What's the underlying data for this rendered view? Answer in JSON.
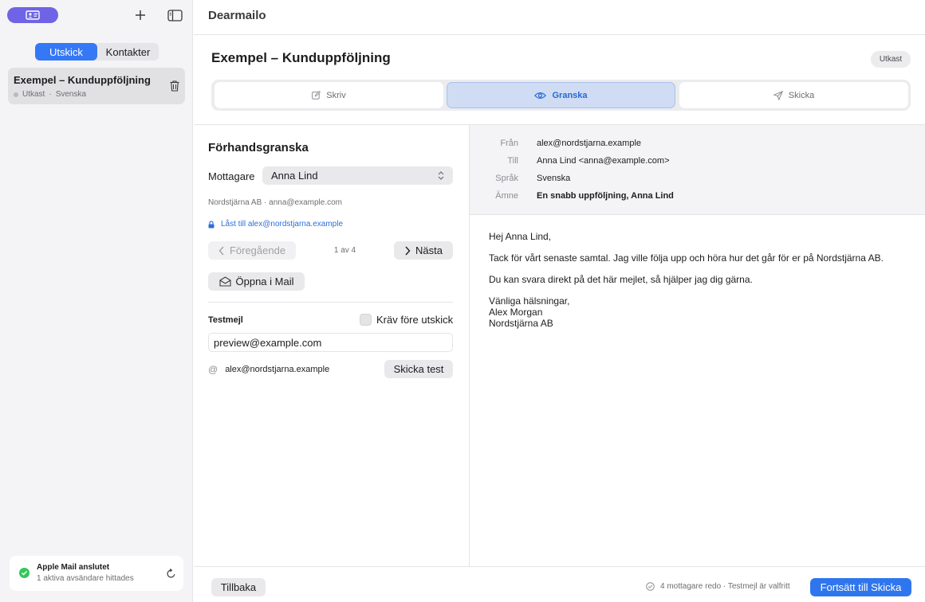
{
  "sidebar": {
    "segments": [
      {
        "label": "Utskick",
        "active": true
      },
      {
        "label": "Kontakter",
        "active": false
      }
    ],
    "campaigns": [
      {
        "title": "Exempel – Kunduppföljning",
        "status": "Utkast",
        "separator": "·",
        "language": "Svenska"
      }
    ],
    "status_card": {
      "title": "Apple Mail anslutet",
      "subtitle": "1 aktiva avsändare hittades"
    },
    "icons": {
      "app": "contact-card-icon",
      "add": "plus-icon",
      "toggle": "sidebar-toggle-icon",
      "delete": "trash-icon",
      "status": "checkmark-circle-icon",
      "refresh": "refresh-icon"
    }
  },
  "header": {
    "app_title": "Dearmailo",
    "doc_title": "Exempel – Kunduppföljning",
    "badge": "Utkast"
  },
  "steps": [
    {
      "label": "Skriv",
      "icon": "edit-icon",
      "active": false
    },
    {
      "label": "Granska",
      "icon": "eye-icon",
      "active": true
    },
    {
      "label": "Skicka",
      "icon": "send-icon",
      "active": false
    }
  ],
  "preview_panel": {
    "heading": "Förhandsgranska",
    "recipient_label": "Mottagare",
    "recipient_value": "Anna Lind",
    "recipient_meta": "Nordstjärna AB · anna@example.com",
    "locked_text": "Låst till alex@nordstjarna.example",
    "prev_label": "Föregående",
    "next_label": "Nästa",
    "pager": "1 av 4",
    "open_mail_label": "Öppna i Mail",
    "test_label": "Testmejl",
    "require_label": "Kräv före utskick",
    "test_email_value": "preview@example.com",
    "sender": "alex@nordstjarna.example",
    "send_test_label": "Skicka test"
  },
  "email_preview": {
    "fields": [
      {
        "label": "Från",
        "value": "alex@nordstjarna.example",
        "bold": false
      },
      {
        "label": "Till",
        "value": "Anna Lind <anna@example.com>",
        "bold": false
      },
      {
        "label": "Språk",
        "value": "Svenska",
        "bold": false
      },
      {
        "label": "Ämne",
        "value": "En snabb uppföljning, Anna Lind",
        "bold": true
      }
    ],
    "greeting": "Hej Anna Lind,",
    "paragraph1": "Tack för vårt senaste samtal. Jag ville följa upp och höra hur det går för er på Nordstjärna AB.",
    "paragraph2": "Du kan svara direkt på det här mejlet, så hjälper jag dig gärna.",
    "signoff": [
      "Vänliga hälsningar,",
      "Alex Morgan",
      "Nordstjärna AB"
    ]
  },
  "footer": {
    "back_label": "Tillbaka",
    "status_text": "4 mottagare redo · Testmejl är valfritt",
    "primary_label": "Fortsätt till Skicka"
  },
  "colors": {
    "accent": "#3478f6",
    "app_pill": "#6f63e6",
    "success": "#34c759",
    "link": "#2d6fd9"
  }
}
